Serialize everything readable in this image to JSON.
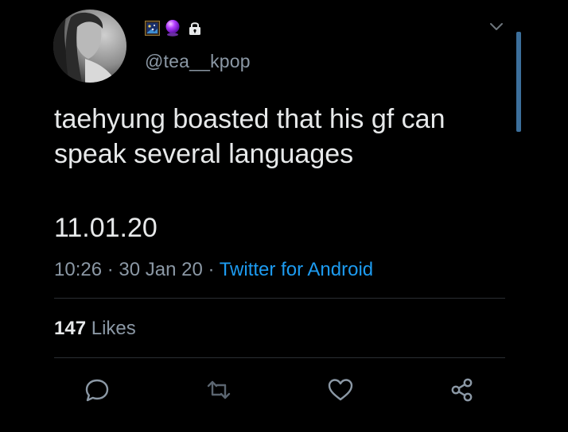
{
  "user": {
    "handle": "@tea__kpop"
  },
  "tweet": {
    "text": "taehyung boasted that his gf can speak several languages",
    "date_line": "11.01.20",
    "time": "10:26",
    "sep1": " · ",
    "date": "30 Jan 20",
    "sep2": " · ",
    "source": "Twitter for Android"
  },
  "engagement": {
    "likes_count": "147",
    "likes_label": "Likes"
  },
  "icons": {
    "frame_emoji": "framed-picture-icon",
    "ball_emoji": "crystal-ball-icon",
    "lock": "lock-icon",
    "more": "chevron-down-icon",
    "reply": "reply-icon",
    "retweet": "retweet-icon",
    "like": "heart-icon",
    "share": "share-icon"
  },
  "colors": {
    "background": "#000000",
    "text": "#e7e9ea",
    "muted": "#8b98a5",
    "link": "#1d9bf0",
    "scrollbar": "#3c6f9b"
  }
}
